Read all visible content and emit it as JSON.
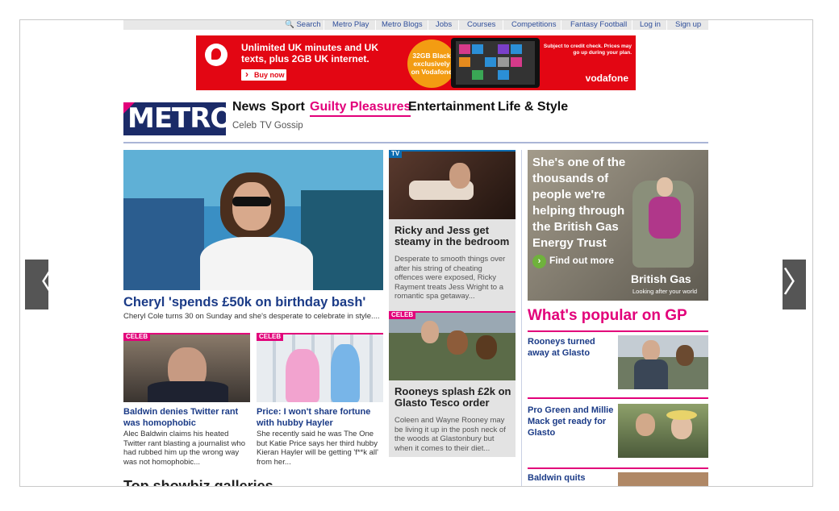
{
  "utility_nav": [
    "Search",
    "Metro Play",
    "Metro Blogs",
    "Jobs",
    "Courses",
    "Competitions",
    "Fantasy Football",
    "Log in",
    "Sign up"
  ],
  "ad": {
    "headline": "Unlimited UK minutes and UK texts, plus 2GB UK internet.",
    "button": "Buy now",
    "badge": "32GB Black exclusively on Vodafone",
    "fineprint": "Subject to credit check. Prices may go up during your plan.",
    "brand": "vodafone"
  },
  "logo": "METRO",
  "nav": {
    "items": [
      "News",
      "Sport",
      "Guilty Pleasures",
      "Entertainment",
      "Life & Style"
    ],
    "active": "Guilty Pleasures",
    "sub": [
      "Celeb",
      "TV Gossip"
    ]
  },
  "lead": {
    "headline": "Cheryl 'spends £50k on birthday bash'",
    "dek": "Cheryl Cole turns 30 on Sunday and she's desperate to celebrate in style...."
  },
  "stories": [
    {
      "tag": "CELEB",
      "headline": "Baldwin denies Twitter rant was homophobic",
      "dek": "Alec Baldwin claims his heated Twitter rant blasting a journalist who had rubbed him up the wrong way was not homophobic..."
    },
    {
      "tag": "CELEB",
      "headline": "Price: I won't share fortune with hubby Hayler",
      "dek": "She recently said he was The One but Katie Price says her third hubby Kieran Hayler will be getting 'f**k all' from her..."
    },
    {
      "tag": "TV",
      "headline": "Ricky and Jess get steamy in the bedroom",
      "dek": "Desperate to smooth things over after his string of cheating offences were exposed, Ricky Rayment treats Jess Wright to a romantic spa getaway..."
    },
    {
      "tag": "CELEB",
      "headline": "Rooneys splash £2k on Glasto Tesco order",
      "dek": "Coleen and Wayne Rooney may be living it up in the posh neck of the woods at Glastonbury but when it comes to their diet..."
    }
  ],
  "side_ad": {
    "text": "She's one of the thousands of people we're helping through the British Gas Energy Trust",
    "cta": "Find out more",
    "brand": "British Gas",
    "tagline": "Looking after your world"
  },
  "popular": {
    "title": "What's popular on GP",
    "items": [
      "Rooneys turned away at Glasto",
      "Pro Green and Millie Mack get ready for Glasto",
      "Baldwin quits"
    ]
  },
  "galleries_title": "Top showbiz galleries",
  "arrows": {
    "prev": "〈",
    "next": "〉"
  },
  "colors": {
    "brand_pink": "#e2007a",
    "brand_navy": "#1b2b68",
    "link_blue": "#1b3b87",
    "vodafone_red": "#e30613"
  }
}
